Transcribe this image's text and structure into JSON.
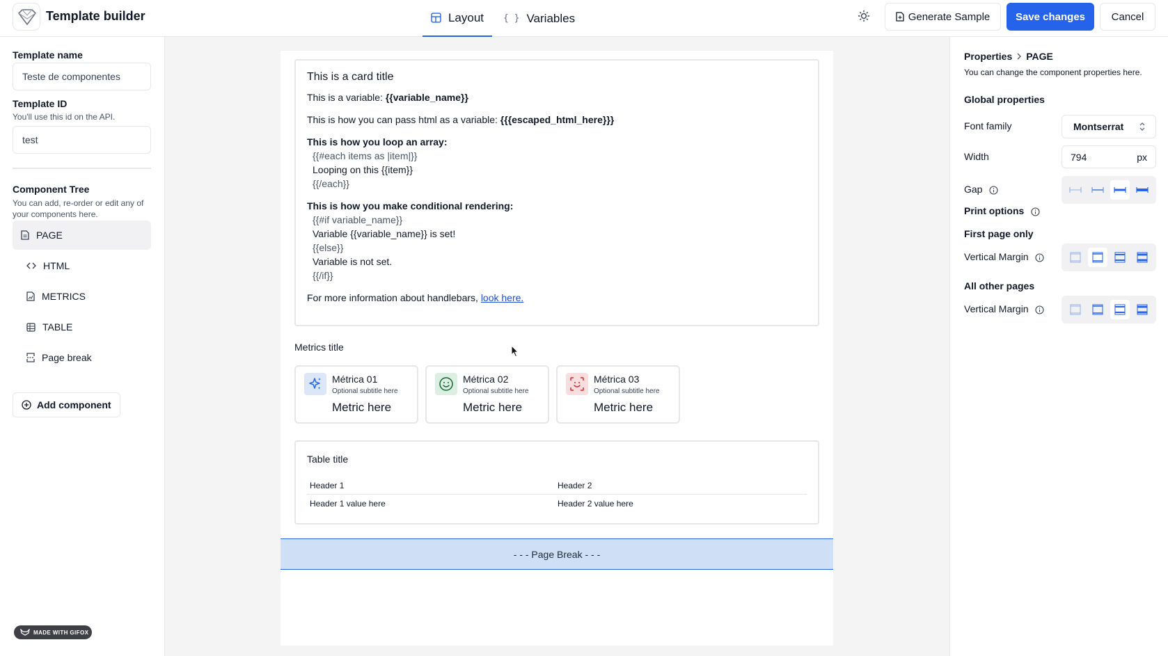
{
  "header": {
    "title": "Template builder",
    "tabs": [
      {
        "label": "Layout",
        "active": true
      },
      {
        "label": "Variables",
        "active": false
      }
    ],
    "generate_label": "Generate Sample",
    "save_label": "Save changes",
    "cancel_label": "Cancel"
  },
  "sidebar": {
    "template_name_label": "Template name",
    "template_name_value": "Teste de componentes",
    "template_id_label": "Template ID",
    "template_id_hint": "You'll use this id on the API.",
    "template_id_value": "test",
    "tree_title": "Component Tree",
    "tree_hint": "You can add, re-order or edit any of your components here.",
    "tree": [
      {
        "label": "PAGE",
        "icon": "file-icon"
      },
      {
        "label": "HTML",
        "icon": "code-icon"
      },
      {
        "label": "METRICS",
        "icon": "metrics-icon"
      },
      {
        "label": "TABLE",
        "icon": "table-icon"
      },
      {
        "label": "Page break",
        "icon": "page-break-icon"
      }
    ],
    "add_component_label": "Add component",
    "made_with": "MADE WITH GIFOX"
  },
  "canvas": {
    "html_card": {
      "title": "This is a card title",
      "var_prefix": "This is a variable: ",
      "var_example": "{{variable_name}}",
      "html_prefix": "This is how you can pass html as a variable: ",
      "html_example": "{{{escaped_html_here}}}",
      "loop_heading": "This is how you loop an array:",
      "loop_lines": [
        "{{#each items as |item|}}",
        "Looping on this {{item}}",
        "{{/each}}"
      ],
      "cond_heading": "This is how you make conditional rendering:",
      "cond_lines": [
        "{{#if variable_name}}",
        "Variable {{variable_name}} is set!",
        "{{else}}",
        "Variable is not set.",
        "{{/if}}"
      ],
      "info_prefix": "For more information about handlebars, ",
      "info_link": "look here."
    },
    "metrics_title": "Metrics title",
    "metrics": [
      {
        "label": "Métrica 01",
        "subtitle": "Optional subtitle here",
        "value": "Metric here",
        "icon": "sparkles-icon",
        "bg": "#dbe6f7",
        "color": "#2563eb"
      },
      {
        "label": "Métrica 02",
        "subtitle": "Optional subtitle here",
        "value": "Metric here",
        "icon": "smile-icon",
        "bg": "#dcefe3",
        "color": "#166534"
      },
      {
        "label": "Métrica 03",
        "subtitle": "Optional subtitle here",
        "value": "Metric here",
        "icon": "face-scan-icon",
        "bg": "#f8dede",
        "color": "#dc2626"
      }
    ],
    "table": {
      "title": "Table title",
      "headers": [
        "Header 1",
        "Header 2"
      ],
      "rows": [
        [
          "Header 1 value here",
          "Header 2 value here"
        ]
      ]
    },
    "page_break_label": "- - - Page Break - - -"
  },
  "properties": {
    "breadcrumb_root": "Properties",
    "breadcrumb_current": "PAGE",
    "hint": "You can change the component properties here.",
    "global_title": "Global properties",
    "font_family_label": "Font family",
    "font_family_value": "Montserrat",
    "width_label": "Width",
    "width_value": "794",
    "width_unit": "px",
    "gap_label": "Gap",
    "gap_selected": 3,
    "print_title": "Print options",
    "first_page_label": "First page only",
    "all_pages_label": "All other pages",
    "vertical_margin_label": "Vertical Margin",
    "first_margin_selected": 2,
    "other_margin_selected": 3
  },
  "accent_color": "#2563eb"
}
